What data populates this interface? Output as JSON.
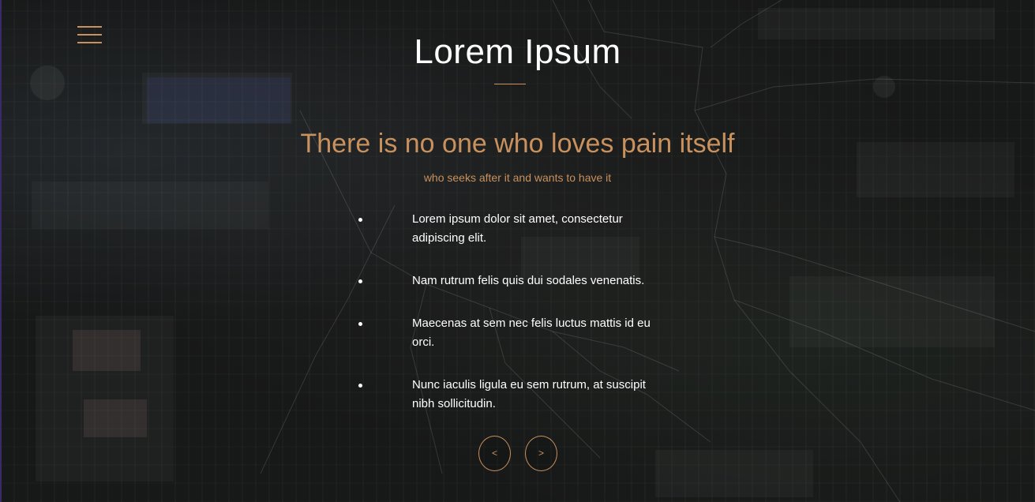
{
  "header": {
    "menu_icon": "hamburger-menu-icon",
    "title": "Lorem Ipsum"
  },
  "hero": {
    "headline": "There is no one who loves pain itself",
    "subheadline": "who seeks after it and wants to have it",
    "items": [
      {
        "text": "Lorem ipsum dolor sit amet, consectetur adipiscing elit."
      },
      {
        "text": "Nam rutrum felis quis dui sodales venenatis."
      },
      {
        "text": "Maecenas at sem nec felis luctus mattis id eu orci."
      },
      {
        "text": "Nunc iaculis ligula eu sem rutrum, at suscipit nibh sollicitudin."
      }
    ]
  },
  "slider": {
    "prev_label": "<",
    "next_label": ">"
  },
  "colors": {
    "accent": "#c8915e",
    "text": "#ffffff",
    "background": "#171818"
  }
}
